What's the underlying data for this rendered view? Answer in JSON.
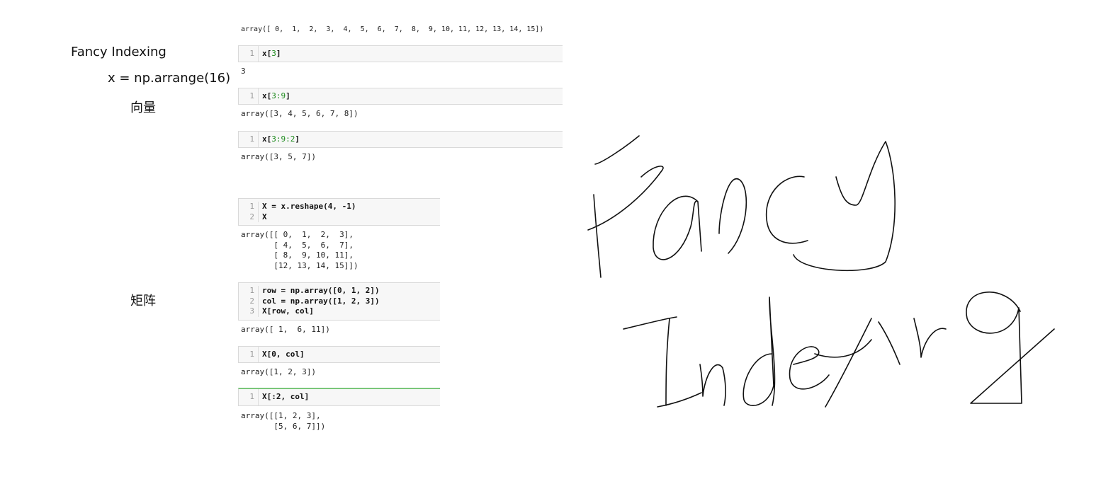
{
  "notes": {
    "heading": "Fancy Indexing",
    "assignment": "x = np.arrange(16)",
    "vector_label": "向量",
    "matrix_label": "矩阵"
  },
  "vector_section": {
    "array_output": "array([ 0,  1,  2,  3,  4,  5,  6,  7,  8,  9, 10, 11, 12, 13, 14, 15])",
    "cells": [
      {
        "line": "1",
        "pre": "x[",
        "arg": "3",
        "post": "]",
        "out": "3"
      },
      {
        "line": "1",
        "pre": "x[",
        "arg": "3:9",
        "post": "]",
        "out": "array([3, 4, 5, 6, 7, 8])"
      },
      {
        "line": "1",
        "pre": "x[",
        "arg": "3:9:2",
        "post": "]",
        "out": "array([3, 5, 7])"
      }
    ]
  },
  "matrix_section": {
    "reshape_cell": {
      "lines": [
        "1",
        "2"
      ],
      "code": [
        "X = x.reshape(4, -1)",
        "X"
      ],
      "out": "array([[ 0,  1,  2,  3],\n       [ 4,  5,  6,  7],\n       [ 8,  9, 10, 11],\n       [12, 13, 14, 15]])"
    },
    "rowcol_cell": {
      "lines": [
        "1",
        "2",
        "3"
      ],
      "code": [
        "row = np.array([0, 1, 2])",
        "col = np.array([1, 2, 3])",
        "X[row, col]"
      ],
      "out": "array([ 1,  6, 11])"
    },
    "zero_col_cell": {
      "line": "1",
      "code": "X[0, col]",
      "out": "array([1, 2, 3])"
    },
    "slice_col_cell": {
      "line": "1",
      "code": "X[:2, col]",
      "out": "array([[1, 2, 3],\n       [5, 6, 7]])"
    }
  },
  "handwriting": {
    "word1": "Fancy",
    "word2": "Indexing",
    "stroke_color": "#111111"
  }
}
